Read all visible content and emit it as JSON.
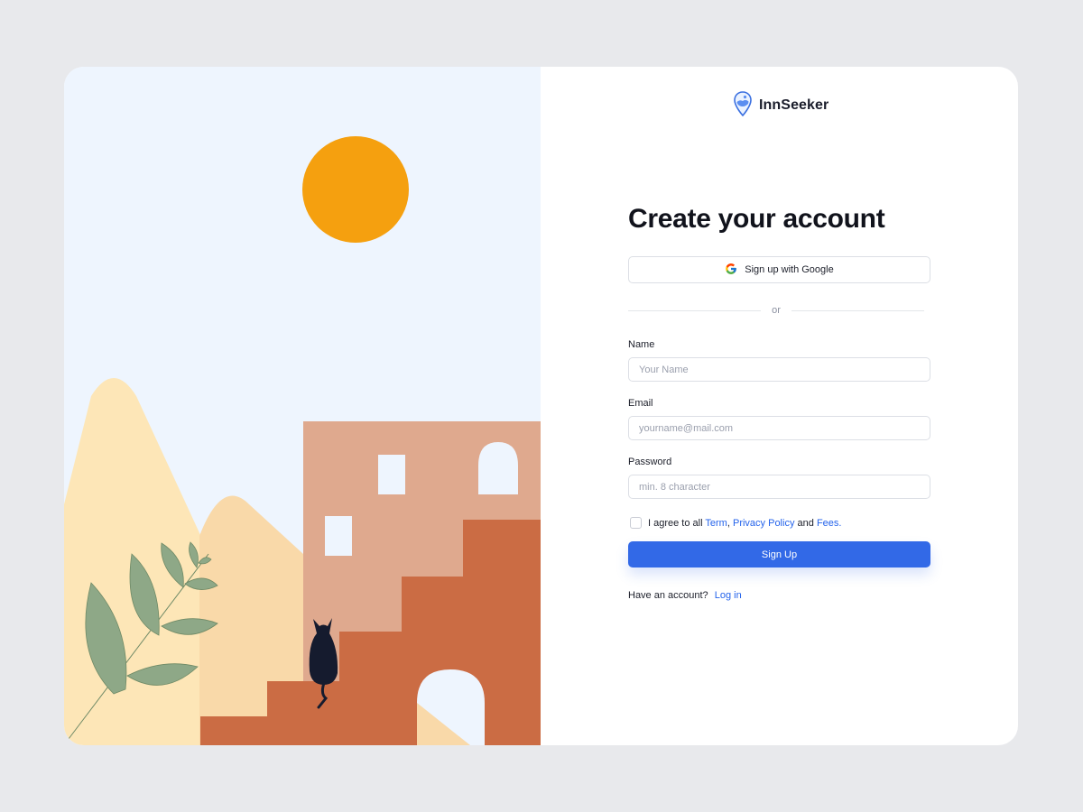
{
  "brand": {
    "name": "InnSeeker"
  },
  "form": {
    "title": "Create your account",
    "google_button": "Sign up with Google",
    "divider": "or",
    "name_label": "Name",
    "name_placeholder": "Your Name",
    "email_label": "Email",
    "email_placeholder": "yourname@mail.com",
    "password_label": "Password",
    "password_placeholder": "min. 8 character",
    "agree_prefix": "I agree to all",
    "agree_term": "Term",
    "agree_comma": ",",
    "agree_privacy": "Privacy Policy",
    "agree_and": "and",
    "agree_fees": "Fees.",
    "signup_button": "Sign Up",
    "have_account": "Have an account?",
    "login_link": "Log in"
  },
  "colors": {
    "primary": "#3269e7",
    "sun": "#f5a00f",
    "sky": "#eef5fe",
    "building": "#dfa98e",
    "stairs": "#cb6c44",
    "leaf": "#8ea887",
    "mountain": "#fde6b7"
  },
  "icons": {
    "logo": "map-pin-icon",
    "google": "google-icon",
    "illustration_subject": "cat-icon"
  }
}
